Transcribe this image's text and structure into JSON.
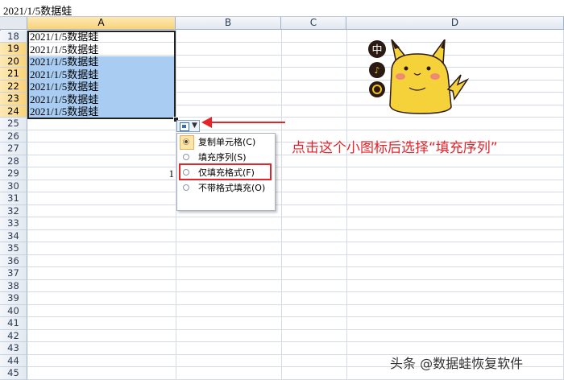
{
  "formula_bar": {
    "value": "2021/1/5数据蛙"
  },
  "columns": [
    "A",
    "B",
    "C",
    "D"
  ],
  "selected_column": "A",
  "rows": [
    "18",
    "19",
    "20",
    "21",
    "22",
    "23",
    "24",
    "25",
    "26",
    "27",
    "28",
    "29",
    "30",
    "31",
    "32",
    "33",
    "34",
    "35",
    "36",
    "37",
    "38",
    "39",
    "40",
    "41",
    "42",
    "43",
    "44",
    "45"
  ],
  "selected_rows": [
    "19",
    "20",
    "21",
    "22",
    "23",
    "24"
  ],
  "cells_A": [
    "2021/1/5数据蛙",
    "2021/1/5数据蛙",
    "2021/1/5数据蛙",
    "2021/1/5数据蛙",
    "2021/1/5数据蛙",
    "2021/1/5数据蛙",
    "2021/1/5数据蛙"
  ],
  "cell_B29": "1",
  "autofill_menu": {
    "items": [
      {
        "label": "复制单元格(C)",
        "checked": true
      },
      {
        "label": "填充序列(S)",
        "checked": false
      },
      {
        "label": "仅填充格式(F)",
        "checked": false
      },
      {
        "label": "不带格式填充(O)",
        "checked": false
      }
    ]
  },
  "annotation": "点击这个小图标后选择“填充序列”",
  "sticker": {
    "badges": [
      "中"
    ]
  },
  "watermark": "头条 @数据蛙恢复软件",
  "colors": {
    "accent_red": "#e5242a",
    "selection": "#a9cdf2",
    "header_selected": "#f8d37a"
  }
}
